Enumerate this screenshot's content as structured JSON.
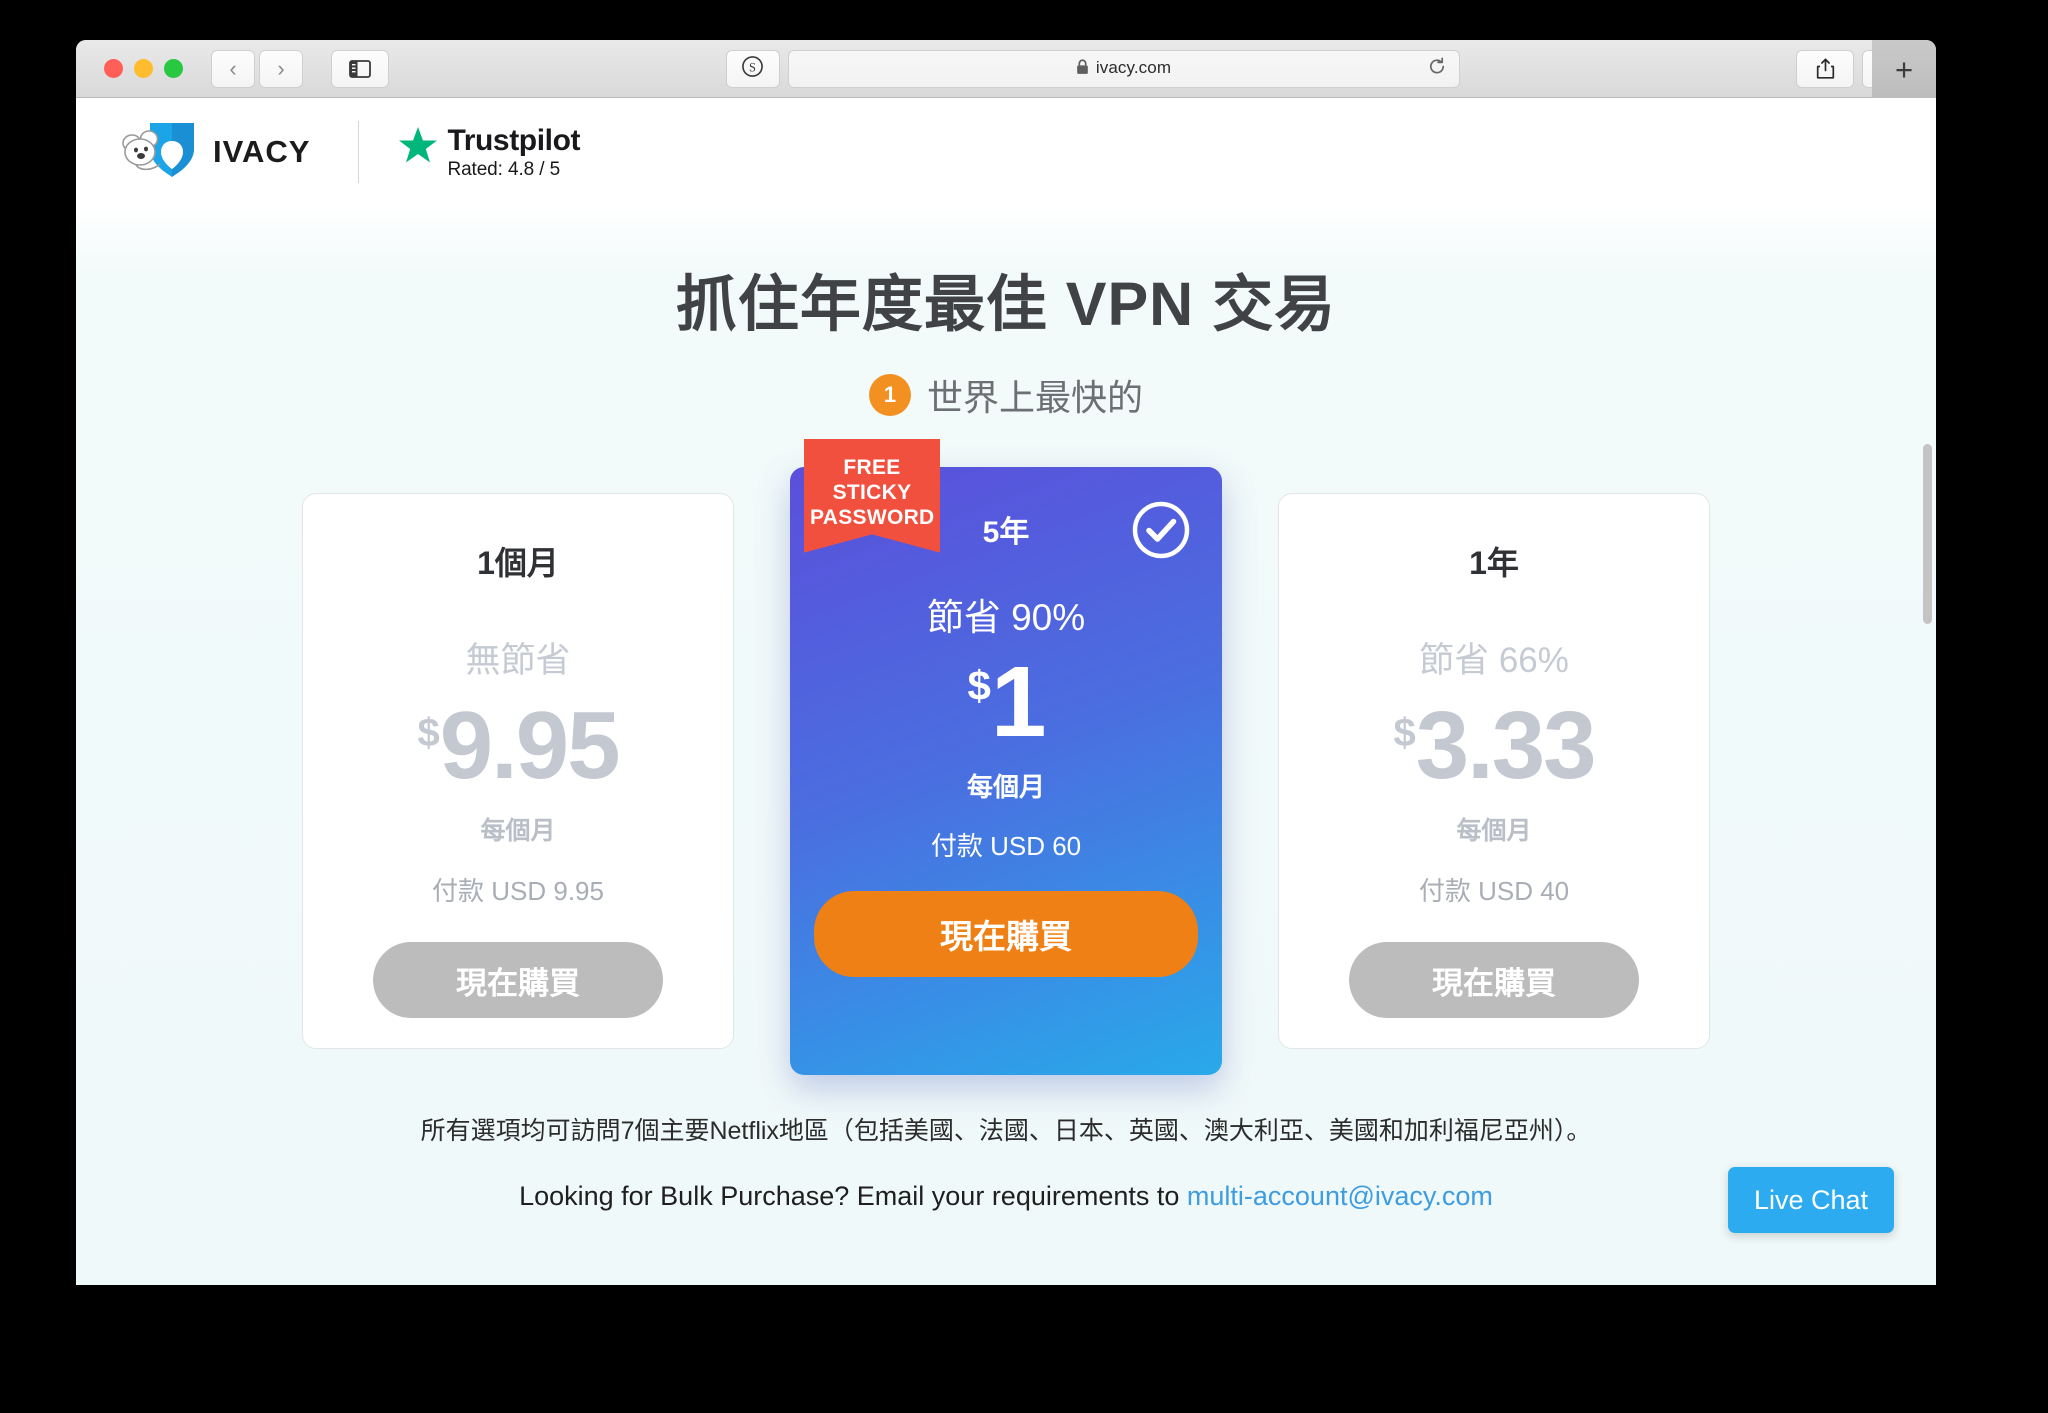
{
  "browser": {
    "traffic_lights": [
      "close",
      "minimize",
      "maximize"
    ],
    "back_label": "‹",
    "forward_label": "›",
    "sidebar_icon": "sidebar-icon",
    "reader_icon": "reader-mode-icon",
    "lock_icon": "lock-icon",
    "url": "ivacy.com",
    "reload_icon": "reload-icon",
    "share_icon": "share-icon",
    "tabs_icon": "show-tabs-icon",
    "new_tab_label": "+"
  },
  "site_header": {
    "logo_icon": "ivacy-koala-shield-logo",
    "brand_name": "IVACY",
    "trustpilot": {
      "star_icon": "trustpilot-star-icon",
      "name": "Trustpilot",
      "rating_text": "Rated: 4.8 / 5"
    }
  },
  "hero": {
    "headline": "抓住年度最佳 VPN 交易",
    "badge_number": "1",
    "subheadline": "世界上最快的"
  },
  "plans": [
    {
      "term": "1個月",
      "savings": "無節省",
      "currency": "$",
      "price": "9.95",
      "per": "每個月",
      "total": "付款 USD 9.95",
      "cta": "現在購買",
      "featured": false
    },
    {
      "term": "5年",
      "savings": "節省 90%",
      "currency": "$",
      "price": "1",
      "per": "每個月",
      "total": "付款 USD 60",
      "cta": "現在購買",
      "featured": true,
      "ribbon": "FREE STICKY PASSWORD",
      "ribbon_lines": [
        "FREE",
        "STICKY",
        "PASSWORD"
      ],
      "selected_icon": "check-circle-icon"
    },
    {
      "term": "1年",
      "savings": "節省 66%",
      "currency": "$",
      "price": "3.33",
      "per": "每個月",
      "total": "付款 USD 40",
      "cta": "現在購買",
      "featured": false
    }
  ],
  "notes": {
    "netflix_note": "所有選項均可訪問7個主要Netflix地區（包括美國、法國、日本、英國、澳大利亞、美國和加利福尼亞州）。",
    "bulk_prefix": "Looking for Bulk Purchase? Email your requirements to ",
    "bulk_email": "multi-account@ivacy.com"
  },
  "live_chat": {
    "label": "Live Chat"
  },
  "colors": {
    "accent_orange": "#ef8016",
    "badge_orange": "#f29122",
    "ribbon_red": "#f2503f",
    "featured_purple": "#5b4fdb",
    "featured_blue": "#29a9ea",
    "live_chat_blue": "#2cabf0",
    "trustpilot_green": "#00b67a",
    "muted_gray": "#c3c8d1",
    "disabled_button": "#bcbcbc"
  }
}
